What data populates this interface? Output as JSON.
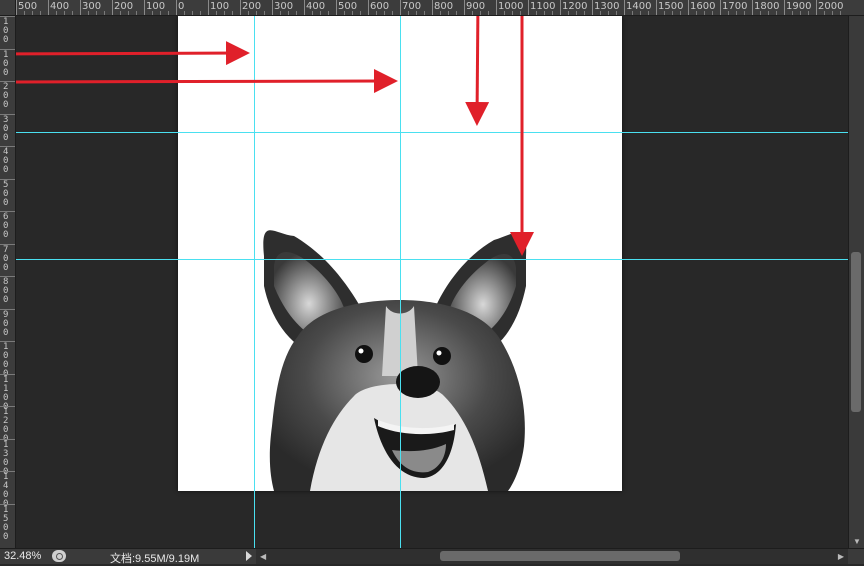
{
  "rulers": {
    "top_labels": [
      "500",
      "400",
      "300",
      "200",
      "100",
      "0",
      "100",
      "200",
      "300",
      "400",
      "500",
      "600",
      "700",
      "800",
      "900",
      "1000",
      "1100",
      "1200",
      "1300",
      "1400",
      "1500",
      "1600",
      "1700",
      "1800",
      "1900",
      "2000"
    ],
    "left_labels": [
      "1\n0\n0",
      "1\n0\n0",
      "2\n0\n0",
      "3\n0\n0",
      "4\n0\n0",
      "5\n0\n0",
      "6\n0\n0",
      "7\n0\n0",
      "8\n0\n0",
      "9\n0\n0",
      "1\n0\n0\n0",
      "1\n1\n0\n0",
      "1\n2\n0\n0",
      "1\n3\n0\n0",
      "1\n4\n0\n0",
      "1\n5\n0\n0"
    ]
  },
  "canvas": {
    "image_icon": "corgi-sketch-image",
    "guide_color": "#4ae0f0",
    "arrow_color": "#e0202a"
  },
  "status": {
    "zoom": "32.48%",
    "doc_info": "文档:9.55M/9.19M"
  }
}
